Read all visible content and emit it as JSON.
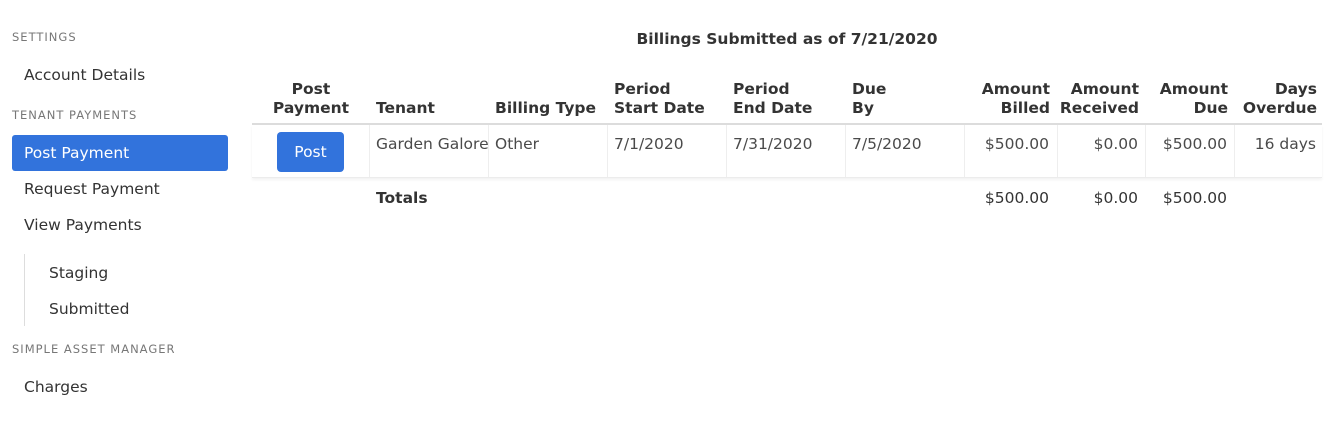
{
  "sidebar": {
    "sections": [
      {
        "heading": "SETTINGS"
      },
      {
        "heading": "TENANT PAYMENTS"
      },
      {
        "heading": "SIMPLE ASSET MANAGER"
      }
    ],
    "items": {
      "account_details": "Account Details",
      "post_payment": "Post Payment",
      "request_payment": "Request Payment",
      "view_payments": "View Payments",
      "staging": "Staging",
      "submitted": "Submitted",
      "charges": "Charges"
    },
    "active_item": "Post Payment",
    "accent_color": "#3273dc"
  },
  "main": {
    "title": "Billings Submitted as of 7/21/2020",
    "table": {
      "headers": {
        "post_payment": [
          "Post",
          "Payment"
        ],
        "tenant": "Tenant",
        "billing_type": "Billing Type",
        "period_start": [
          "Period",
          "Start Date"
        ],
        "period_end": [
          "Period",
          "End Date"
        ],
        "due_by": [
          "Due",
          "By"
        ],
        "amount_billed": [
          "Amount",
          "Billed"
        ],
        "amount_received": [
          "Amount",
          "Received"
        ],
        "amount_due": [
          "Amount",
          "Due"
        ],
        "days_overdue": [
          "Days",
          "Overdue"
        ]
      },
      "rows": [
        {
          "action_label": "Post",
          "tenant": "Garden Galore",
          "billing_type": "Other",
          "period_start": "7/1/2020",
          "period_end": "7/31/2020",
          "due_by": "7/5/2020",
          "amount_billed": "$500.00",
          "amount_received": "$0.00",
          "amount_due": "$500.00",
          "days_overdue": "16 days"
        }
      ],
      "totals": {
        "label": "Totals",
        "amount_billed": "$500.00",
        "amount_received": "$0.00",
        "amount_due": "$500.00"
      }
    }
  }
}
